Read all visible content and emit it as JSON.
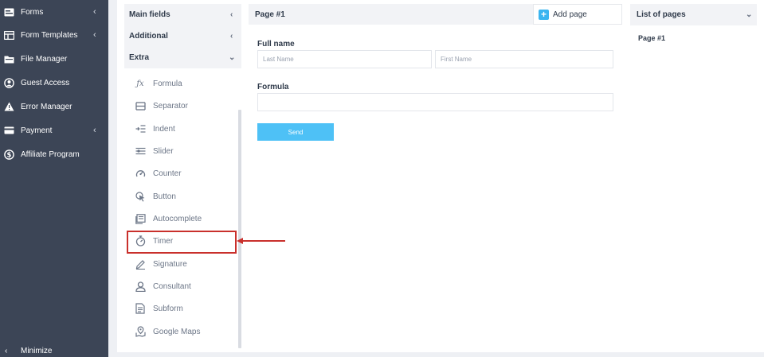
{
  "nav": {
    "items": [
      {
        "label": "Forms",
        "icon": "forms-icon",
        "has_submenu": true
      },
      {
        "label": "Form Templates",
        "icon": "form-templates-icon",
        "has_submenu": true
      },
      {
        "label": "File Manager",
        "icon": "file-manager-icon",
        "has_submenu": false
      },
      {
        "label": "Guest Access",
        "icon": "user-circle-icon",
        "has_submenu": false
      },
      {
        "label": "Error Manager",
        "icon": "warning-icon",
        "has_submenu": false
      },
      {
        "label": "Payment",
        "icon": "payment-card-icon",
        "has_submenu": true
      },
      {
        "label": "Affiliate Program",
        "icon": "dollar-icon",
        "has_submenu": false
      }
    ],
    "minimize_label": "Minimize"
  },
  "fields_panel": {
    "groups": [
      {
        "label": "Main fields",
        "expanded": false
      },
      {
        "label": "Additional",
        "expanded": false
      },
      {
        "label": "Extra",
        "expanded": true
      }
    ],
    "items": [
      {
        "label": "Formula",
        "icon": "formula-icon"
      },
      {
        "label": "Separator",
        "icon": "separator-icon"
      },
      {
        "label": "Indent",
        "icon": "indent-icon"
      },
      {
        "label": "Slider",
        "icon": "slider-icon"
      },
      {
        "label": "Counter",
        "icon": "counter-icon"
      },
      {
        "label": "Button",
        "icon": "button-pointer-icon"
      },
      {
        "label": "Autocomplete",
        "icon": "autocomplete-icon"
      },
      {
        "label": "Timer",
        "icon": "stopwatch-icon",
        "highlighted": true
      },
      {
        "label": "Signature",
        "icon": "signature-icon"
      },
      {
        "label": "Consultant",
        "icon": "consultant-icon"
      },
      {
        "label": "Subform",
        "icon": "subform-icon"
      },
      {
        "label": "Google Maps",
        "icon": "map-icon"
      }
    ]
  },
  "builder": {
    "page_tab": "Page #1",
    "add_page_label": "Add page",
    "full_name_label": "Full name",
    "last_name_placeholder": "Last Name",
    "first_name_placeholder": "First Name",
    "formula_label": "Formula",
    "send_label": "Send"
  },
  "pages_list": {
    "header": "List of pages",
    "pages": [
      "Page #1"
    ]
  },
  "colors": {
    "sidebar": "#3c4556",
    "accent": "#4ec1f6",
    "highlight": "#c9302c"
  }
}
